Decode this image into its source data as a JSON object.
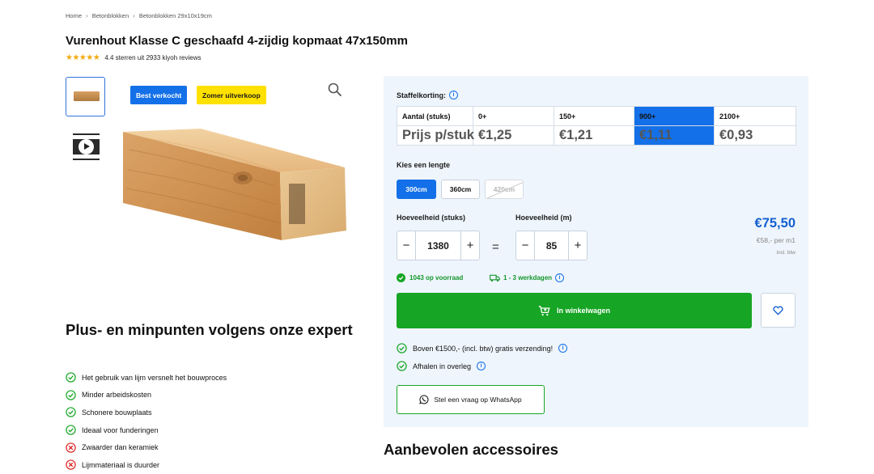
{
  "breadcrumb": {
    "items": [
      "Home",
      "Betonblokken",
      "Betonblokken 29x10x19cm"
    ],
    "separator": "›"
  },
  "product": {
    "title": "Vurenhout Klasse C geschaafd 4-zijdig kopmaat 47x150mm",
    "rating_text": "4.4 sterren uit 2933 kiyoh reviews",
    "rating_value": 4.4,
    "rating_max": 5,
    "badges": [
      "Best verkocht",
      "Zomer uitverkoop"
    ]
  },
  "expert": {
    "heading": "Plus- en minpunten volgens onze expert",
    "items": [
      {
        "type": "plus",
        "text": "Het gebruik van lijm versnelt het bouwproces"
      },
      {
        "type": "plus",
        "text": "Minder arbeidskosten"
      },
      {
        "type": "plus",
        "text": "Schonere bouwplaats"
      },
      {
        "type": "plus",
        "text": "Ideaal voor funderingen"
      },
      {
        "type": "min",
        "text": "Zwaarder dan keramiek"
      },
      {
        "type": "min",
        "text": "Lijmmateriaal is duurder"
      }
    ]
  },
  "staffel": {
    "heading": "Staffelkorting:",
    "row_header": "Aantal (stuks)",
    "price_header": "Prijs p/stuk",
    "tiers": [
      "0+",
      "150+",
      "900+",
      "2100+"
    ],
    "prices": [
      "€1,25",
      "€1,21",
      "€1,11",
      "€0,93"
    ],
    "selected_index": 2
  },
  "length": {
    "heading": "Kies een lengte",
    "options": [
      "300cm",
      "360cm",
      "420cm"
    ],
    "selected": "300cm",
    "unavailable": "420cm"
  },
  "quantity": {
    "pieces_label": "Hoeveelheid (stuks)",
    "pieces_value": "1380",
    "meters_label": "Hoeveelheid (m)",
    "meters_value": "85",
    "minus": "−",
    "plus": "+",
    "equals": "="
  },
  "pricing": {
    "total": "€75,50",
    "per_meter": "€58,- per m1",
    "vat_note": "incl. btw"
  },
  "availability": {
    "stock": "1043 op voorraad",
    "delivery": "1 - 3 werkdagen"
  },
  "actions": {
    "cart_label": "In winkelwagen",
    "whatsapp_label": "Stel een vraag op WhatsApp"
  },
  "perks": [
    "Boven €1500,- (incl. btw) gratis verzending!",
    "Afhalen in overleg"
  ],
  "accessories_heading": "Aanbevolen accessoires",
  "colors": {
    "accent": "#1470e8",
    "cta": "#16a524",
    "badge_yellow": "#ffe100",
    "price": "#1460d0",
    "panel": "#eef5fc",
    "danger": "#e02424"
  },
  "icons": {
    "zoom": "search-icon",
    "cart": "cart-icon",
    "wishlist": "heart-icon",
    "whatsapp": "whatsapp-icon",
    "info": "info-icon",
    "check": "check-circle-icon",
    "cross": "cross-circle-icon",
    "truck": "truck-icon",
    "play": "play-icon"
  }
}
